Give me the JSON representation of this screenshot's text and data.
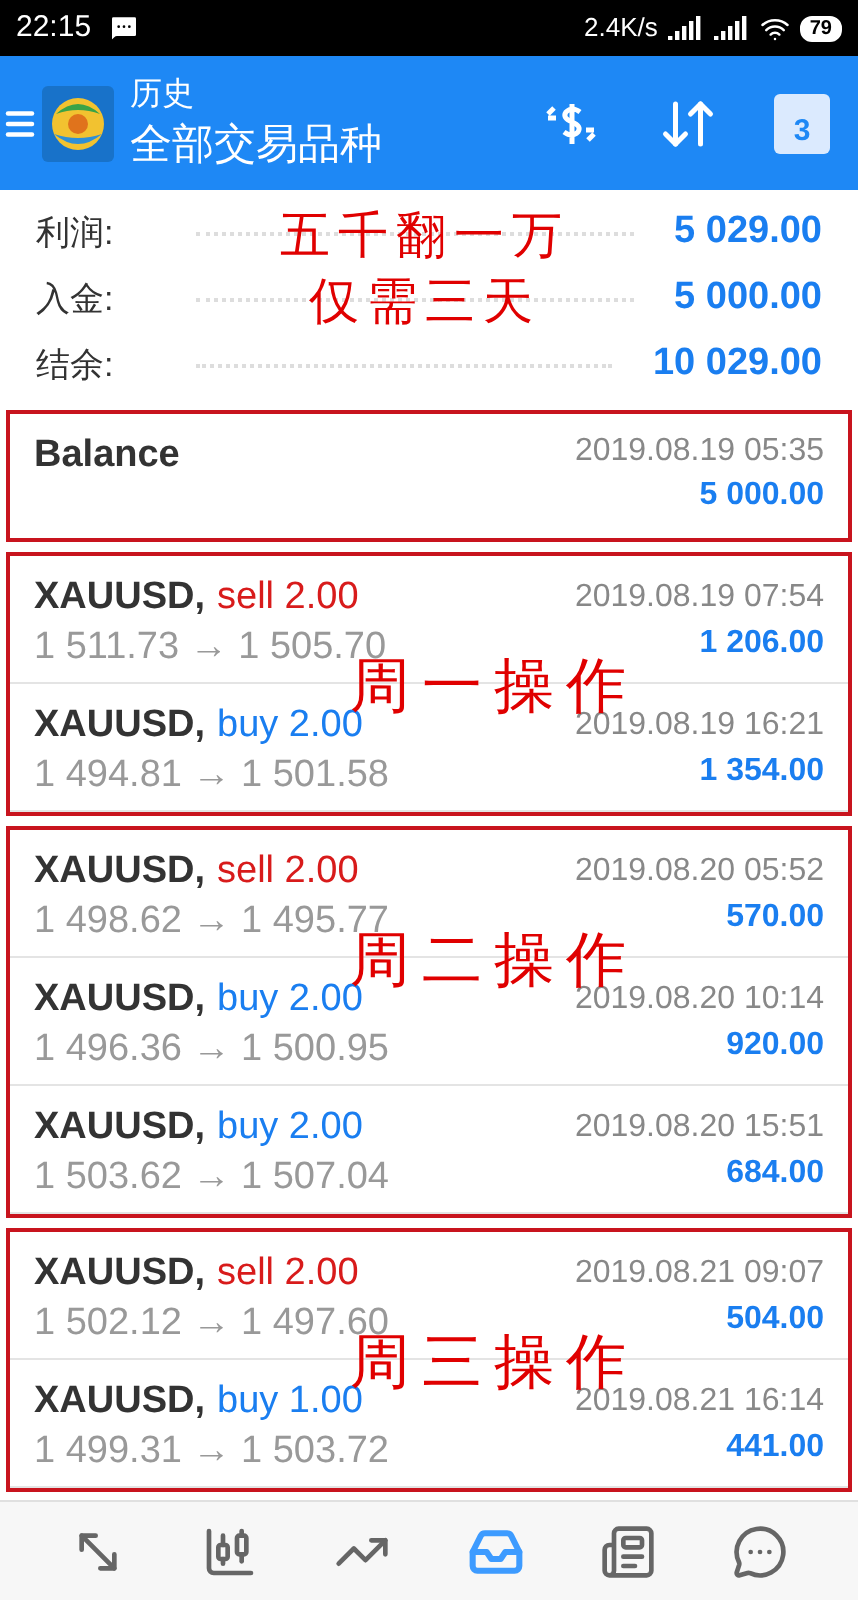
{
  "status_bar": {
    "time": "22:15",
    "speed": "2.4K/s",
    "battery": "79"
  },
  "app_bar": {
    "title": "历史",
    "subtitle": "全部交易品种",
    "calendar_day": "3"
  },
  "summary": [
    {
      "label": "利润:",
      "value": "5 029.00"
    },
    {
      "label": "入金:",
      "value": "5 000.00"
    },
    {
      "label": "结余:",
      "value": "10 029.00"
    }
  ],
  "headline": [
    "五千翻一万",
    "仅需三天"
  ],
  "groups": [
    {
      "entries": [
        {
          "kind": "balance",
          "title": "Balance",
          "date": "2019.08.19 05:35",
          "amount": "5 000.00"
        }
      ]
    },
    {
      "annotation": "周一操作",
      "entries": [
        {
          "kind": "sell",
          "symbol": "XAUUSD,",
          "action": "sell 2.00",
          "prices": "1 511.73 → 1 505.70",
          "date": "2019.08.19 07:54",
          "amount": "1 206.00"
        },
        {
          "kind": "buy",
          "symbol": "XAUUSD,",
          "action": "buy 2.00",
          "prices": "1 494.81 → 1 501.58",
          "date": "2019.08.19 16:21",
          "amount": "1 354.00"
        }
      ]
    },
    {
      "annotation": "周二操作",
      "entries": [
        {
          "kind": "sell",
          "symbol": "XAUUSD,",
          "action": "sell 2.00",
          "prices": "1 498.62 → 1 495.77",
          "date": "2019.08.20 05:52",
          "amount": "570.00"
        },
        {
          "kind": "buy",
          "symbol": "XAUUSD,",
          "action": "buy 2.00",
          "prices": "1 496.36 → 1 500.95",
          "date": "2019.08.20 10:14",
          "amount": "920.00"
        },
        {
          "kind": "buy",
          "symbol": "XAUUSD,",
          "action": "buy 2.00",
          "prices": "1 503.62 → 1 507.04",
          "date": "2019.08.20 15:51",
          "amount": "684.00"
        }
      ]
    },
    {
      "annotation": "周三操作",
      "entries": [
        {
          "kind": "sell",
          "symbol": "XAUUSD,",
          "action": "sell 2.00",
          "prices": "1 502.12 → 1 497.60",
          "date": "2019.08.21 09:07",
          "amount": "504.00"
        },
        {
          "kind": "buy",
          "symbol": "XAUUSD,",
          "action": "buy 1.00",
          "prices": "1 499.31 → 1 503.72",
          "date": "2019.08.21 16:14",
          "amount": "441.00"
        }
      ]
    }
  ],
  "nav": [
    {
      "kind": "quotes",
      "selected": false
    },
    {
      "kind": "chart",
      "selected": false
    },
    {
      "kind": "trade",
      "selected": false
    },
    {
      "kind": "history",
      "selected": true
    },
    {
      "kind": "news",
      "selected": false
    },
    {
      "kind": "chat",
      "selected": false
    }
  ]
}
